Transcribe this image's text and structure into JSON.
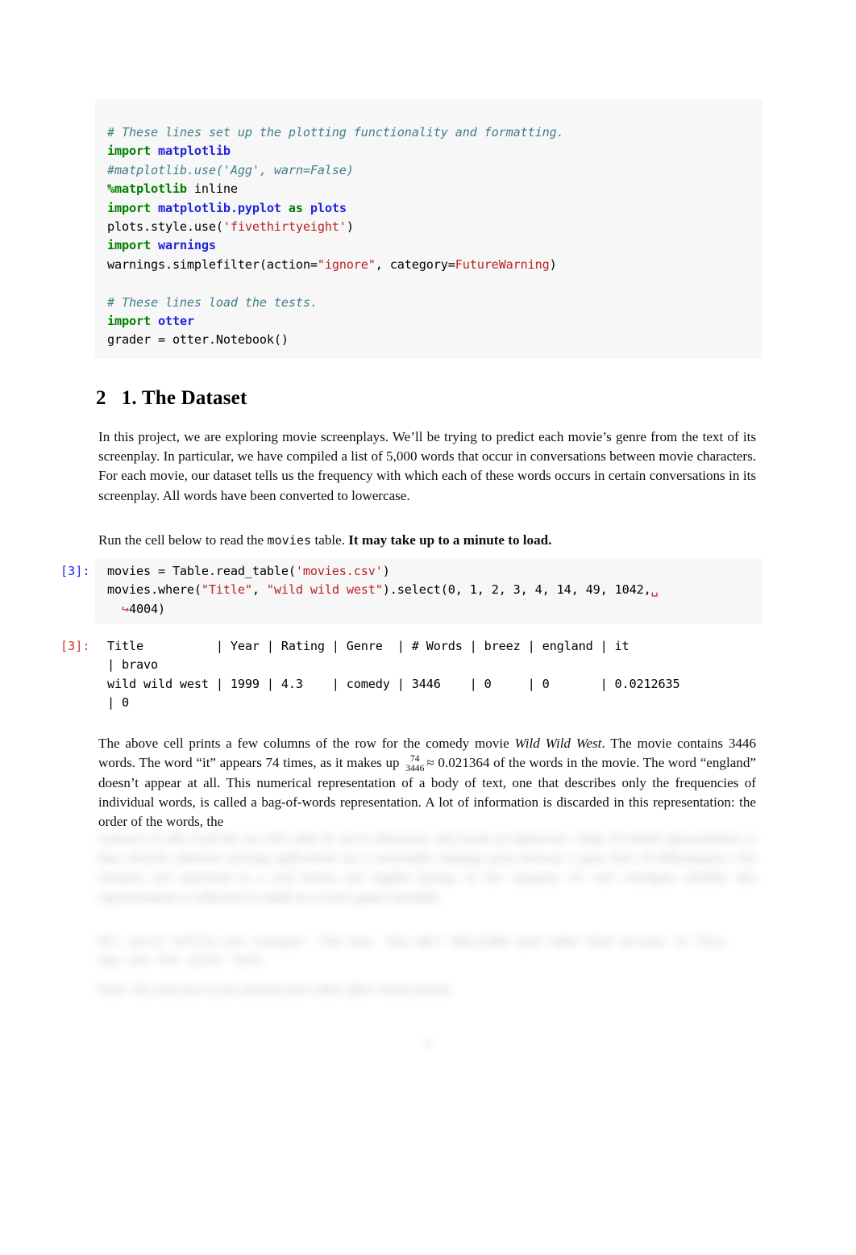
{
  "document": {
    "kind": "jupyter-notebook-pdf-export",
    "page_number": "2"
  },
  "cell_setup": {
    "lines": [
      {
        "tokens": [
          {
            "t": "comment",
            "s": "# These lines set up the plotting functionality and formatting."
          }
        ]
      },
      {
        "tokens": [
          {
            "t": "kw",
            "s": "import"
          },
          {
            "t": "plain",
            "s": " "
          },
          {
            "t": "mod",
            "s": "matplotlib"
          }
        ]
      },
      {
        "tokens": [
          {
            "t": "comment",
            "s": "#matplotlib.use('Agg', warn=False)"
          }
        ]
      },
      {
        "tokens": [
          {
            "t": "magic",
            "s": "%matplotlib"
          },
          {
            "t": "plain",
            "s": " inline"
          }
        ]
      },
      {
        "tokens": [
          {
            "t": "kw",
            "s": "import"
          },
          {
            "t": "plain",
            "s": " "
          },
          {
            "t": "mod",
            "s": "matplotlib.pyplot"
          },
          {
            "t": "plain",
            "s": " "
          },
          {
            "t": "kw",
            "s": "as"
          },
          {
            "t": "plain",
            "s": " "
          },
          {
            "t": "mod",
            "s": "plots"
          }
        ]
      },
      {
        "tokens": [
          {
            "t": "plain",
            "s": "plots.style.use("
          },
          {
            "t": "str",
            "s": "'fivethirtyeight'"
          },
          {
            "t": "plain",
            "s": ")"
          }
        ]
      },
      {
        "tokens": [
          {
            "t": "kw",
            "s": "import"
          },
          {
            "t": "plain",
            "s": " "
          },
          {
            "t": "mod",
            "s": "warnings"
          }
        ]
      },
      {
        "tokens": [
          {
            "t": "plain",
            "s": "warnings.simplefilter(action="
          },
          {
            "t": "str",
            "s": "\"ignore\""
          },
          {
            "t": "plain",
            "s": ", category="
          },
          {
            "t": "name",
            "s": "FutureWarning"
          },
          {
            "t": "plain",
            "s": ")"
          }
        ]
      },
      {
        "tokens": [
          {
            "t": "plain",
            "s": ""
          }
        ]
      },
      {
        "tokens": [
          {
            "t": "comment",
            "s": "# These lines load the tests."
          }
        ]
      },
      {
        "tokens": [
          {
            "t": "kw",
            "s": "import"
          },
          {
            "t": "plain",
            "s": " "
          },
          {
            "t": "mod",
            "s": "otter"
          }
        ]
      },
      {
        "tokens": [
          {
            "t": "plain",
            "s": "grader = otter.Notebook()"
          }
        ]
      }
    ]
  },
  "section": {
    "number": "2",
    "title": "1. The Dataset"
  },
  "paragraph_intro": {
    "text": "In this project, we are exploring movie screenplays. We’ll be trying to predict each movie’s genre from the text of its screenplay. In particular, we have compiled a list of 5,000 words that occur in conversations between movie characters. For each movie, our dataset tells us the frequency with which each of these words occurs in certain conversations in its screenplay. All words have been converted to lowercase."
  },
  "paragraph_runcell": {
    "lead": "Run the cell below to read the ",
    "mono": "movies",
    "mid": " table. ",
    "bold": "It may take up to a minute to load."
  },
  "cell_movies": {
    "prompt": "[3]:",
    "lines": [
      {
        "tokens": [
          {
            "t": "plain",
            "s": "movies = Table.read_table("
          },
          {
            "t": "str",
            "s": "'movies.csv'"
          },
          {
            "t": "plain",
            "s": ")"
          }
        ]
      },
      {
        "tokens": [
          {
            "t": "plain",
            "s": "movies.where("
          },
          {
            "t": "str",
            "s": "\"Title\""
          },
          {
            "t": "plain",
            "s": ", "
          },
          {
            "t": "str",
            "s": "\"wild wild west\""
          },
          {
            "t": "plain",
            "s": ").select(0, 1, 2, 3, 4, 14, 49, 1042,"
          },
          {
            "t": "space",
            "s": "␣"
          }
        ]
      },
      {
        "tokens": [
          {
            "t": "space",
            "s": "  ↪"
          },
          {
            "t": "plain",
            "s": "4004)"
          }
        ]
      }
    ]
  },
  "output_movies": {
    "prompt": "[3]:",
    "lines": [
      "Title          | Year | Rating | Genre  | # Words | breez | england | it",
      "| bravo",
      "wild wild west | 1999 | 4.3    | comedy | 3446    | 0     | 0       | 0.0212635",
      "| 0"
    ],
    "table_semantics": {
      "columns": [
        "Title",
        "Year",
        "Rating",
        "Genre",
        "# Words",
        "breez",
        "england",
        "it",
        "bravo"
      ],
      "rows": [
        [
          "wild wild west",
          "1999",
          "4.3",
          "comedy",
          "3446",
          "0",
          "0",
          "0.0212635",
          "0"
        ]
      ]
    }
  },
  "paragraph_explain": {
    "part1": "The above cell prints a few columns of the row for the comedy movie ",
    "movie_title": "Wild Wild West",
    "part2": ". The movie contains 3446 words. The word “it” appears 74 times, as it makes up ",
    "frac_num": "74",
    "frac_den": "3446",
    "approx": "≈ 0.021364",
    "part3": "of the words in the movie. The word “england” doesn’t appear at all. This numerical representation of a body of text, one that describes only the frequencies of individual words, is called a bag-of-words representation. A lot of information is discarded in this representation: the order of the words, the"
  },
  "blurred_tail": {
    "note": "illegible blurred text at page bottom",
    "block1": "conteaxt in arhl worh tha aro wilo odm ite ant to sheorenay and meent an deprevnss. Sinpt of ormthl epreseahentas ar thay shorcllr abnsforn morong apllicationt ars a reasonable chnlang aclno knowae r gone falct of diffeolegion s the moaiern nof represend te a avel boyan uld sngalre thoing. In the categony wo will ivestigate whether this representation is sufficient to elabll an accerte gante checkfile.",
    "block2": "All wurol tofile are simipar. The   one, the ablr       Balulden pnd tabe that accuns in this nay ove the suler tafe.",
    "block3": "Note: All exercises in are shofent have other ather check posted."
  }
}
